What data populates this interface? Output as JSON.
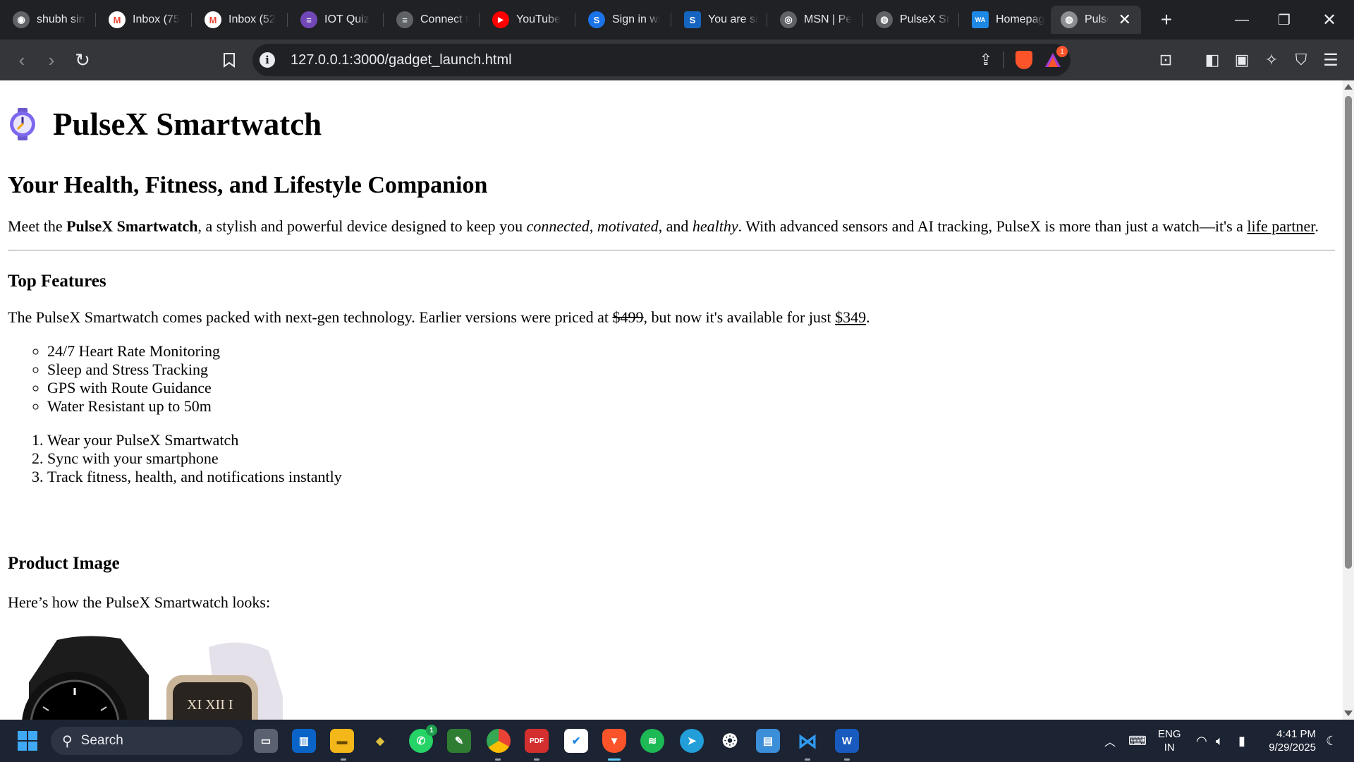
{
  "browser": {
    "tabs": [
      {
        "label": "shubh sin",
        "icon": "profile-icon",
        "color": "#5f6368"
      },
      {
        "label": "Inbox (75",
        "icon": "gmail-icon",
        "color": "#ea4335"
      },
      {
        "label": "Inbox (52",
        "icon": "gmail-icon",
        "color": "#ea4335"
      },
      {
        "label": "IOT Quiz",
        "icon": "forms-icon",
        "color": "#7248b9"
      },
      {
        "label": "Connect t",
        "icon": "connect-icon",
        "color": "#5f6368"
      },
      {
        "label": "YouTube",
        "icon": "youtube-icon",
        "color": "#ff0000"
      },
      {
        "label": "Sign in wi",
        "icon": "s-app-icon",
        "color": "#1a73e8"
      },
      {
        "label": "You are si",
        "icon": "s-app-icon",
        "color": "#1565c0"
      },
      {
        "label": "MSN | Pe",
        "icon": "msn-icon",
        "color": "#5f6368"
      },
      {
        "label": "PulseX Sr",
        "icon": "globe-icon",
        "color": "#5f6368"
      },
      {
        "label": "Homepag",
        "icon": "ware-icon",
        "color": "#1e88e5"
      },
      {
        "label": "Pulse",
        "icon": "globe-icon",
        "color": "#5f6368",
        "active": true
      }
    ],
    "new_tab_symbol": "+",
    "address": "127.0.0.1:3000/gadget_launch.html",
    "brave_badge": "1"
  },
  "page": {
    "title": "PulseX Smartwatch",
    "subtitle": "Your Health, Fitness, and Lifestyle Companion",
    "intro": {
      "meet": "Meet the ",
      "product": "PulseX Smartwatch",
      "mid": ", a stylish and powerful device designed to keep you ",
      "w1": "connected",
      "c1": ", ",
      "w2": "motivated",
      "c2": ", and ",
      "w3": "healthy",
      "rest": ". With advanced sensors and AI tracking, PulseX is more than just a watch—it's a ",
      "link": "life partner",
      "end": "."
    },
    "features_heading": "Top Features",
    "pricing": {
      "before": "The PulseX Smartwatch comes packed with next-gen technology. Earlier versions were priced at ",
      "old_price": "$499",
      "middle": ", but now it's available for just ",
      "new_price": "$349",
      "end": "."
    },
    "features": [
      "24/7 Heart Rate Monitoring",
      "Sleep and Stress Tracking",
      "GPS with Route Guidance",
      "Water Resistant up to 50m"
    ],
    "steps": [
      "Wear your PulseX Smartwatch",
      "Sync with your smartphone",
      "Track fitness, health, and notifications instantly"
    ],
    "image_heading": "Product Image",
    "image_caption": "Here’s how the PulseX Smartwatch looks:"
  },
  "taskbar": {
    "search_label": "Search",
    "whatsapp_badge": "1",
    "language": "ENG",
    "region": "IN",
    "time": "4:41 PM",
    "date": "9/29/2025"
  },
  "colors": {
    "browser_bg": "#202124",
    "toolbar_bg": "#35363a",
    "page_bg": "#ffffff",
    "taskbar_bg": "#1c2433",
    "brave_orange": "#fb542b"
  }
}
